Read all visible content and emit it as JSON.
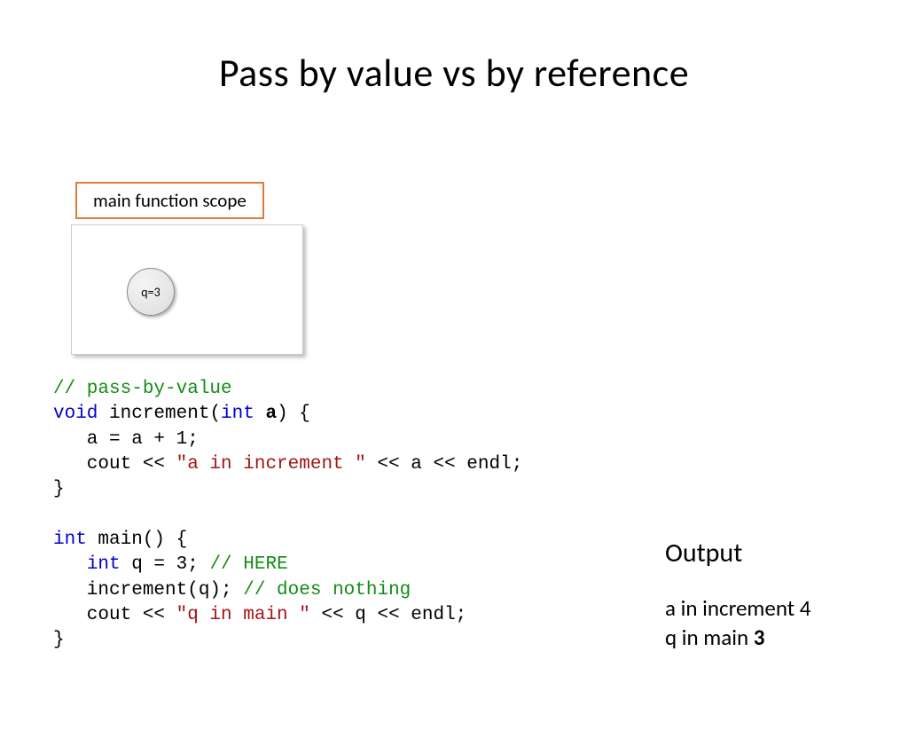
{
  "title": "Pass by value vs by reference",
  "scope": {
    "label": "main function scope",
    "variable": "q=3"
  },
  "code": {
    "c1": "// pass-by-value",
    "l2a": "void",
    "l2b": " increment(",
    "l2c": "int",
    "l2d": " ",
    "l2e": "a",
    "l2f": ") {",
    "l3": "   a = a + 1;",
    "l4a": "   cout << ",
    "l4b": "\"a in increment \"",
    "l4c": " << a << endl;",
    "l5": "}",
    "l6a": "int",
    "l6b": " main() {",
    "l7a": "   ",
    "l7b": "int",
    "l7c": " q = 3; ",
    "l7d": "// HERE",
    "l8a": "   increment(q); ",
    "l8b": "// does nothing",
    "l9a": "   cout << ",
    "l9b": "\"q in main \"",
    "l9c": " << q << endl;",
    "l10": "}"
  },
  "output": {
    "heading": "Output",
    "line1a": "a in increment ",
    "line1b": "4",
    "line2a": "q in main ",
    "line2b": "3"
  }
}
